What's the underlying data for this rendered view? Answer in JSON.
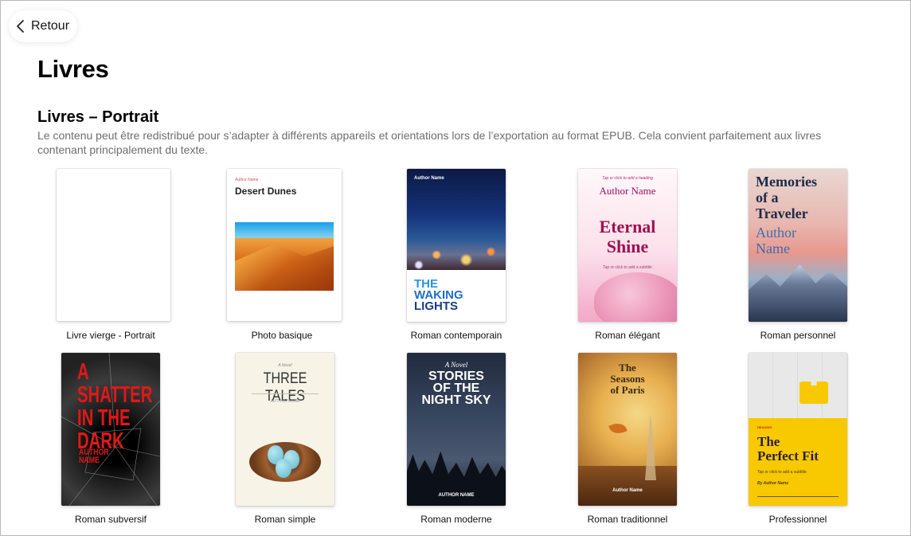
{
  "back_label": "Retour",
  "page_title": "Livres",
  "section": {
    "title": "Livres – Portrait",
    "description": "Le contenu peut être redistribué pour s’adapter à différents appareils et orientations lors de l’exportation au format EPUB. Cela convient parfaitement aux livres contenant principalement du texte."
  },
  "templates": [
    {
      "label": "Livre vierge - Portrait"
    },
    {
      "label": "Photo basique",
      "cover": {
        "author": "Author Name",
        "title": "Desert Dunes"
      }
    },
    {
      "label": "Roman contemporain",
      "cover": {
        "author": "Author Name",
        "title_lines": [
          "THE",
          "WAKING",
          "LIGHTS"
        ]
      }
    },
    {
      "label": "Roman élégant",
      "cover": {
        "heading": "Tap or click to add a heading",
        "author": "Author Name",
        "title_lines": [
          "Eternal",
          "Shine"
        ],
        "subtitle": "Tap or click to add a subtitle"
      }
    },
    {
      "label": "Roman personnel",
      "cover": {
        "title_lines": [
          "Memories",
          "of a",
          "Traveler"
        ],
        "author_lines": [
          "Author",
          "Name"
        ]
      }
    },
    {
      "label": "Roman subversif",
      "cover": {
        "title_lines": [
          "A",
          "SHATTER",
          "IN THE",
          "DARK"
        ],
        "author_lines": [
          "AUTHOR",
          "NAME"
        ]
      }
    },
    {
      "label": "Roman simple",
      "cover": {
        "kicker": "A Novel",
        "title": "THREE TALES",
        "author": "AUTHOR NAME"
      }
    },
    {
      "label": "Roman moderne",
      "cover": {
        "kicker": "A Novel",
        "title_lines": [
          "STORIES",
          "OF THE",
          "NIGHT SKY"
        ],
        "author": "AUTHOR NAME"
      }
    },
    {
      "label": "Roman traditionnel",
      "cover": {
        "title_lines": [
          "The",
          "Seasons",
          "of Paris"
        ],
        "author": "Author Name"
      }
    },
    {
      "label": "Professionnel",
      "cover": {
        "kicker": "HEADING",
        "title_lines": [
          "The",
          "Perfect Fit"
        ],
        "subtitle": "Tap or click to add a subtitle",
        "author": "By Author Name"
      }
    }
  ]
}
